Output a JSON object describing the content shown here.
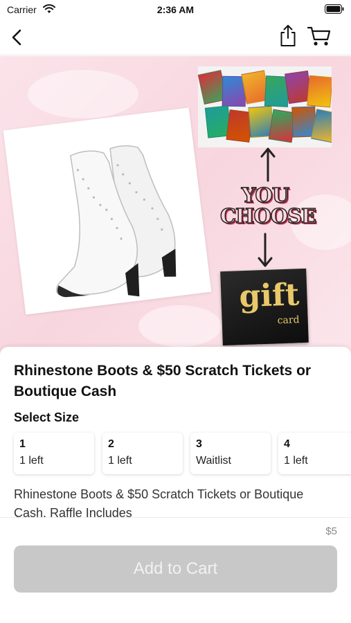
{
  "status_bar": {
    "carrier": "Carrier",
    "time": "2:36 AM"
  },
  "icons": {
    "back": "chevron-left-icon",
    "share": "share-icon",
    "cart": "cart-icon",
    "wifi": "wifi-icon",
    "battery": "battery-icon"
  },
  "hero": {
    "you_choose": "YOU CHOOSE",
    "gift_word": "gift",
    "card_word": "card",
    "ticket_colors": [
      "#d9313c",
      "#2e8bd6",
      "#f0b52a",
      "#3aa55b",
      "#8e44ad",
      "#e86a2d",
      "#1e9c9c",
      "#c0392b",
      "#f1c40f",
      "#27ae60",
      "#d35400",
      "#2c7fb8"
    ]
  },
  "product": {
    "title": "Rhinestone Boots & $50 Scratch Tickets or Boutique Cash",
    "select_size_label": "Select Size",
    "sizes": [
      {
        "size": "1",
        "status": "1 left"
      },
      {
        "size": "2",
        "status": "1 left"
      },
      {
        "size": "3",
        "status": "Waitlist"
      },
      {
        "size": "4",
        "status": "1 left"
      }
    ],
    "description": "Rhinestone Boots & $50 Scratch Tickets or Boutique Cash. Raffle Includes"
  },
  "footer": {
    "price": "$5",
    "add_to_cart_label": "Add to Cart"
  },
  "colors": {
    "button_disabled": "#c8c8c8",
    "hero_pink": "#f8d6df",
    "gold": "#e8c86a"
  }
}
